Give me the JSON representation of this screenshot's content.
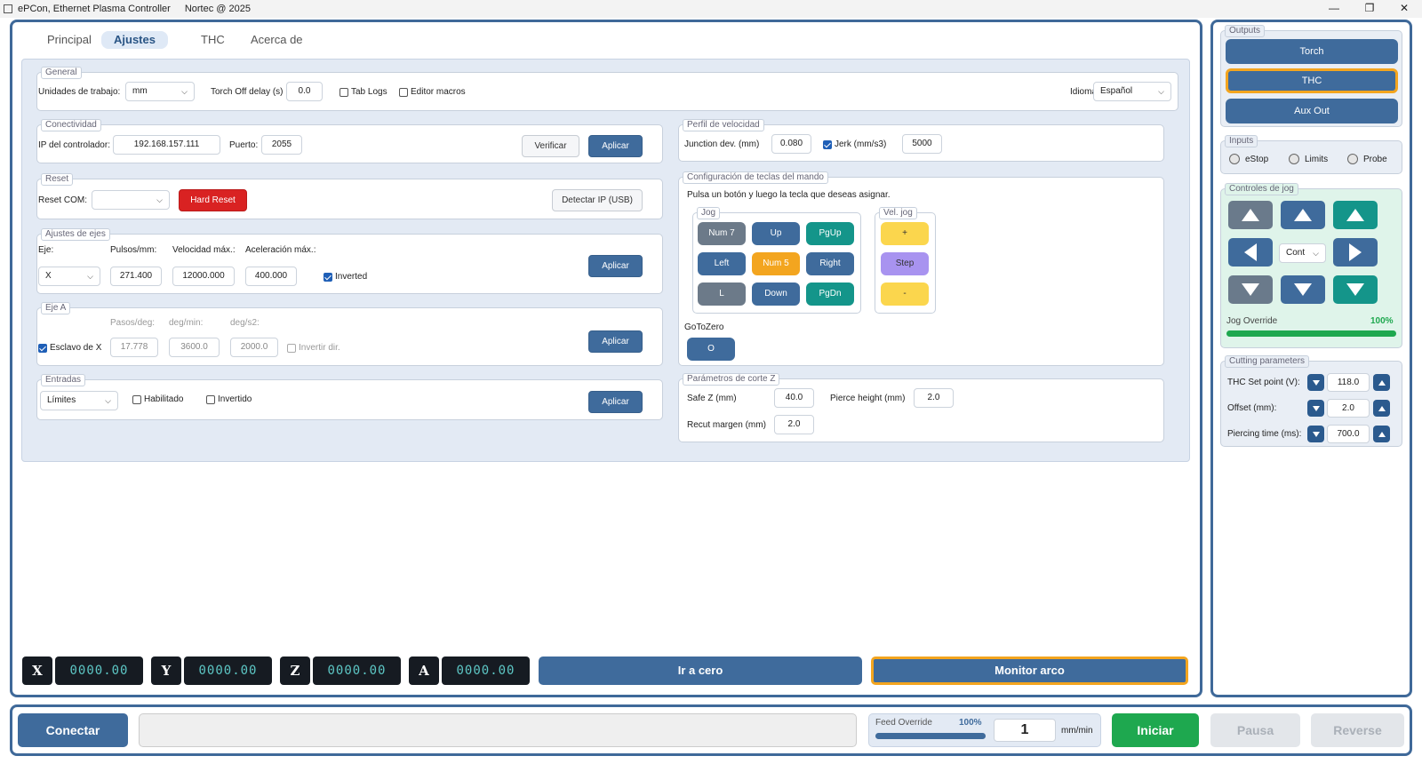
{
  "titlebar": {
    "app_title": "ePCon, Ethernet Plasma Controller",
    "copyright": "Nortec @ 2025",
    "minimize": "—",
    "maximize": "❐",
    "close": "✕"
  },
  "tabs": [
    {
      "label": "Principal"
    },
    {
      "label": "Ajustes",
      "active": true
    },
    {
      "label": "THC"
    },
    {
      "label": "Acerca de"
    }
  ],
  "general": {
    "title": "General",
    "units_label": "Unidades de trabajo:",
    "units_value": "mm",
    "torch_off_label": "Torch Off delay (s)",
    "torch_off_value": "0.0",
    "tab_logs": "Tab Logs",
    "editor_macros": "Editor macros",
    "idioma_label": "Idioma:",
    "idioma_value": "Español"
  },
  "conectividad": {
    "title": "Conectividad",
    "ip_label": "IP del controlador:",
    "ip_value": "192.168.157.111",
    "puerto_label": "Puerto:",
    "puerto_value": "2055",
    "verify": "Verificar",
    "apply": "Aplicar"
  },
  "reset": {
    "title": "Reset",
    "com_label": "Reset COM:",
    "com_value": "",
    "hard_reset": "Hard Reset",
    "detect_ip": "Detectar IP (USB)"
  },
  "axes": {
    "title": "Ajustes de ejes",
    "eje_label": "Eje:",
    "pulsos_label": "Pulsos/mm:",
    "vel_label": "Velocidad máx.:",
    "acel_label": "Aceleración máx.:",
    "eje_value": "X",
    "pulsos_value": "271.400",
    "vel_value": "12000.000",
    "acel_value": "400.000",
    "inverted": "Inverted",
    "apply": "Aplicar"
  },
  "eje_a": {
    "title": "Eje A",
    "pasos_label": "Pasos/deg:",
    "degmin_label": "deg/min:",
    "degs2_label": "deg/s2:",
    "slave": "Esclavo de X",
    "pasos_value": "17.778",
    "degmin_value": "3600.0",
    "degs2_value": "2000.0",
    "invert": "Invertir dir.",
    "apply": "Aplicar"
  },
  "entradas": {
    "title": "Entradas",
    "value": "Límites",
    "habilitado": "Habilitado",
    "invertido": "Invertido",
    "apply": "Aplicar"
  },
  "velocidad": {
    "title": "Perfil de velocidad",
    "junction_label": "Junction dev. (mm)",
    "junction_value": "0.080",
    "jerk_label": "Jerk (mm/s3)",
    "jerk_value": "5000"
  },
  "teclas": {
    "title": "Configuración de teclas del mando",
    "hint": "Pulsa un botón y luego la tecla que deseas asignar.",
    "jog_title": "Jog",
    "vel_title": "Vel. jog",
    "jog_keys": [
      "Num 7",
      "Up",
      "PgUp",
      "Left",
      "Num 5",
      "Right",
      "L",
      "Down",
      "PgDn"
    ],
    "vel_keys": [
      "+",
      "Step",
      "-"
    ],
    "gotozero_label": "GoToZero",
    "gotozero_key": "O"
  },
  "corte_z": {
    "title": "Parámetros de corte Z",
    "safe_label": "Safe Z (mm)",
    "safe_value": "40.0",
    "pierce_label": "Pierce height (mm)",
    "pierce_value": "2.0",
    "recut_label": "Recut margen (mm)",
    "recut_value": "2.0"
  },
  "dro": {
    "axes": [
      {
        "name": "X",
        "value": "0000.00"
      },
      {
        "name": "Y",
        "value": "0000.00"
      },
      {
        "name": "Z",
        "value": "0000.00"
      },
      {
        "name": "A",
        "value": "0000.00"
      }
    ],
    "ir_cero": "Ir a cero",
    "monitor": "Monitor arco"
  },
  "outputs": {
    "title": "Outputs",
    "torch": "Torch",
    "thc": "THC",
    "aux": "Aux Out"
  },
  "inputs": {
    "title": "Inputs",
    "items": [
      "eStop",
      "Limits",
      "Probe"
    ]
  },
  "jog": {
    "title": "Controles de jog",
    "mode": "Cont",
    "override_label": "Jog Override",
    "override_value": "100%",
    "override_fraction": 1.0
  },
  "cutting": {
    "title": "Cutting parameters",
    "rows": [
      {
        "label": "THC Set point (V):",
        "value": "118.0"
      },
      {
        "label": "Offset (mm):",
        "value": "2.0"
      },
      {
        "label": "Piercing time (ms):",
        "value": "700.0"
      }
    ]
  },
  "bottom": {
    "connect": "Conectar",
    "status": "",
    "feed_label": "Feed Override",
    "feed_value": "100%",
    "feed_fraction": 1.0,
    "rate_value": "1",
    "rate_unit": "mm/min",
    "start": "Iniciar",
    "pause": "Pausa",
    "reverse": "Reverse"
  },
  "colors": {
    "primary": "#3f6b9c",
    "accent_orange": "#f3a51f",
    "teal": "#14958a",
    "green": "#1ea84f",
    "red": "#d92222"
  }
}
